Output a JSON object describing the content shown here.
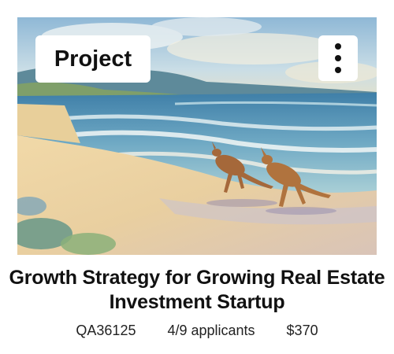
{
  "card": {
    "tag": "Project",
    "title": "Growth Strategy for Growing Real Estate Investment Startup",
    "project_id": "QA36125",
    "applicants": "4/9 applicants",
    "price": "$370"
  },
  "icons": {
    "menu": "more-vertical-icon"
  }
}
